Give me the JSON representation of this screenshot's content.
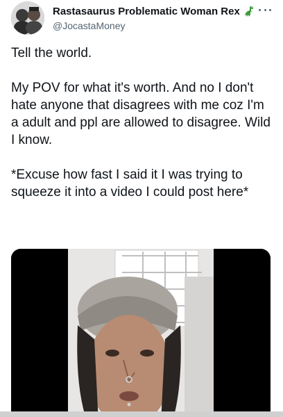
{
  "user": {
    "display_name": "Rastasaurus Problematic Woman Rex",
    "handle": "@JocastaMoney",
    "badge_icon": "dinosaur-icon",
    "badge_color": "#3a9b3a"
  },
  "tweet": {
    "paragraphs": [
      "Tell the world.",
      "My POV for what it's worth. And no I don't hate anyone that disagrees with me coz I'm a adult and ppl are allowed to disagree. Wild I know.",
      "*Excuse how fast I said it I was trying to squeeze it into a video I could post here*"
    ]
  },
  "media": {
    "type": "video",
    "background": "#000000"
  },
  "icons": {
    "more": "more-options-icon"
  },
  "colors": {
    "text": "#0f1419",
    "secondary": "#536471"
  }
}
